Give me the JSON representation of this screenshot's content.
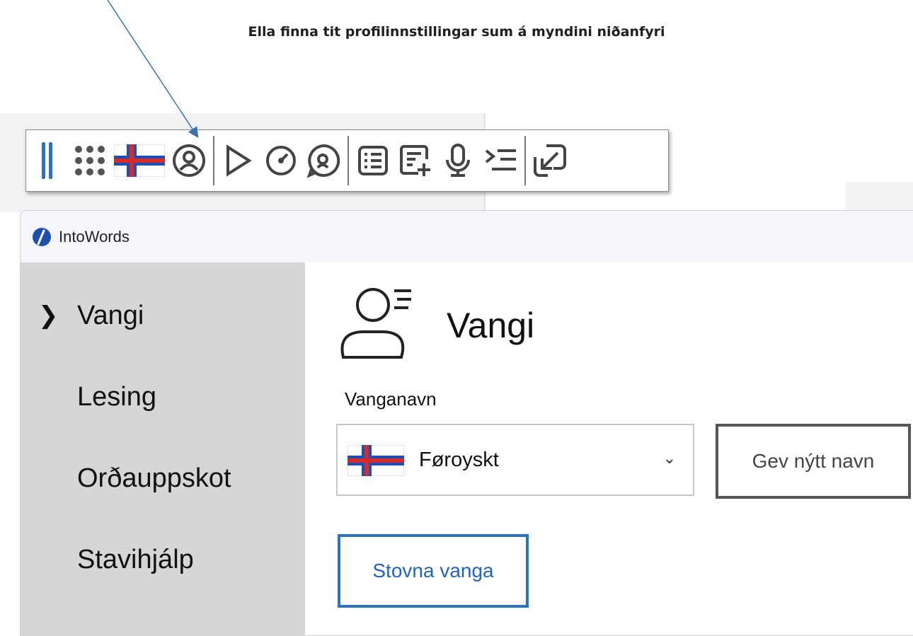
{
  "caption": "Ella finna tit profilinnstillingar sum á myndini niðanfyri",
  "colors": {
    "accent": "#2a73c4",
    "flag_blue": "#1f4fb5",
    "flag_red": "#d32b2b",
    "sidebar_bg": "#d6d6d6"
  },
  "toolbar": {
    "buttons": [
      {
        "icon": "drag-handle-icon"
      },
      {
        "icon": "apps-grid-icon"
      },
      {
        "icon": "faroese-flag-icon"
      },
      {
        "icon": "profile-icon"
      },
      {
        "icon": "play-icon"
      },
      {
        "icon": "speed-icon"
      },
      {
        "icon": "voice-icon"
      },
      {
        "icon": "list-icon"
      },
      {
        "icon": "add-document-icon"
      },
      {
        "icon": "microphone-icon"
      },
      {
        "icon": "indent-icon"
      },
      {
        "icon": "minimize-icon"
      }
    ]
  },
  "app": {
    "title": "IntoWords",
    "logo": "intowords-logo-icon"
  },
  "sidebar": {
    "items": [
      {
        "label": "Vangi",
        "selected": true,
        "chevron": "❯"
      },
      {
        "label": "Lesing"
      },
      {
        "label": "Orðauppskot"
      },
      {
        "label": "Stavihjálp"
      }
    ]
  },
  "main": {
    "title": "Vangi",
    "field_label": "Vanganavn",
    "select": {
      "value": "Føroyskt",
      "chevron": "⌄"
    },
    "rename_button": "Gev nýtt navn",
    "create_button": "Stovna vanga"
  }
}
